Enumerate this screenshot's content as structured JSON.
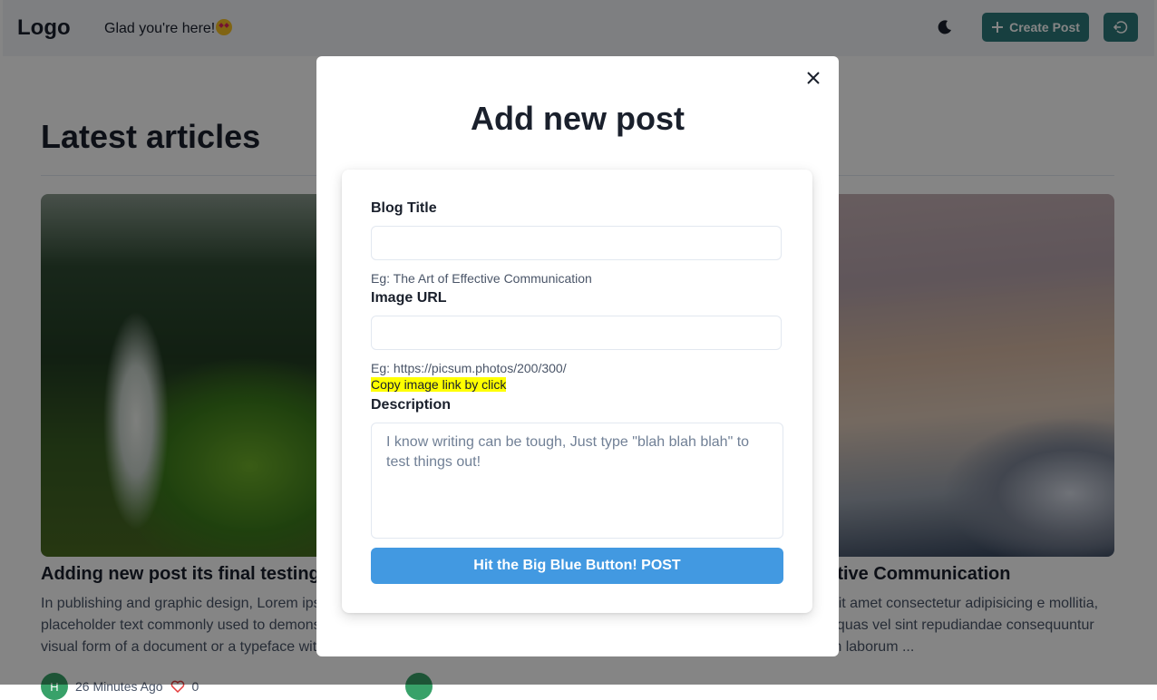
{
  "nav": {
    "logo": "Logo",
    "greeting": "Glad you're here!",
    "greeting_emoji": "star-struck-emoji",
    "theme_icon": "moon-icon",
    "create_label": "Create Post",
    "logout_icon": "logout-icon",
    "accent_color": "#2c7a7b"
  },
  "page": {
    "heading": "Latest articles",
    "cards": [
      {
        "title": "Adding new post its final testing",
        "excerpt": "In publishing and graphic design, Lorem ipsum is a placeholder text commonly used to demonstrate the visual form of a document or a typeface wit",
        "avatar": "H",
        "time": "26 Minutes Ago",
        "likes": "0"
      },
      {
        "title": "of Effective Communication",
        "excerpt": "um dolor sit amet consectetur adipisicing e mollitia, molestiae quas vel sint repudiandae consequuntur voluptatum laborum ..."
      }
    ]
  },
  "modal": {
    "title": "Add new post",
    "close_icon": "close-icon",
    "blog_title_label": "Blog Title",
    "blog_title_value": "",
    "blog_title_hint": "Eg: The Art of Effective Communication",
    "image_url_label": "Image URL",
    "image_url_value": "",
    "image_url_hint": "Eg: https://picsum.photos/200/300/",
    "copy_link": "Copy image link by click",
    "description_label": "Description",
    "description_placeholder": "I know writing can be tough, Just type \"blah blah blah\" to test things out!",
    "submit_label": "Hit the Big Blue Button! POST",
    "submit_color": "#4299e1"
  }
}
